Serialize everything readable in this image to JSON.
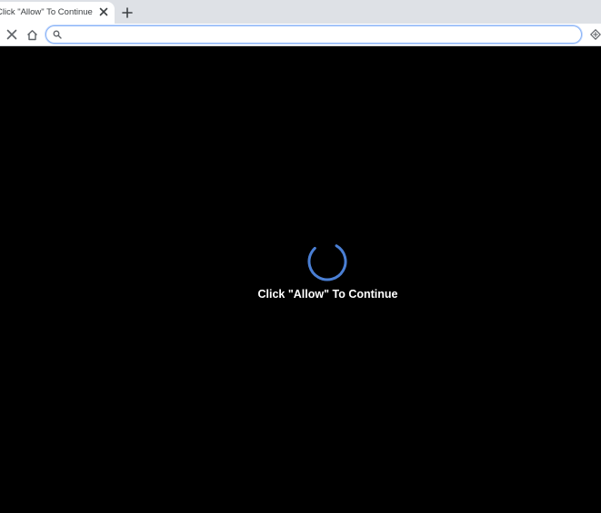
{
  "tab": {
    "title": "Click \"Allow\" To Continue",
    "close_icon": "close-icon",
    "new_tab_icon": "plus-icon"
  },
  "toolbar": {
    "stop_icon": "close-icon",
    "home_icon": "home-icon",
    "omnibox": {
      "value": "",
      "search_icon": "search-icon"
    },
    "extension_icon": "extension-icon"
  },
  "page": {
    "background": "#000000",
    "spinner_color": "#4a7fd4",
    "message": "Click \"Allow\" To Continue"
  }
}
